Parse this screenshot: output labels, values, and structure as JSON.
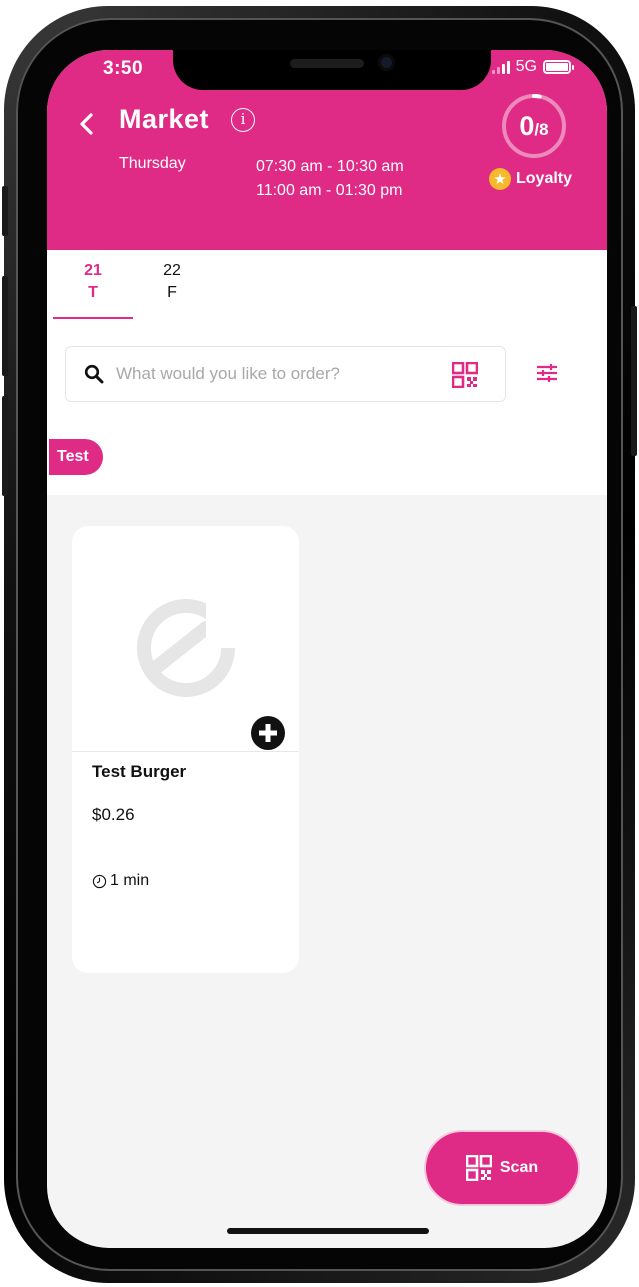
{
  "status": {
    "time": "3:50",
    "network": "5G"
  },
  "header": {
    "title": "Market",
    "info_icon_label": "i",
    "day": "Thursday",
    "hours": [
      "07:30 am - 10:30 am",
      "11:00 am - 01:30 pm"
    ]
  },
  "loyalty": {
    "count": "0",
    "total": "/8",
    "label": "Loyalty",
    "progress_fraction": 0.03
  },
  "date_tabs": [
    {
      "day_number": "21",
      "day_letter": "T",
      "active": true
    },
    {
      "day_number": "22",
      "day_letter": "F",
      "active": false
    }
  ],
  "search": {
    "placeholder": "What would you like to order?",
    "value": ""
  },
  "categories": [
    {
      "label": "Test",
      "active": true
    }
  ],
  "products": [
    {
      "name": "Test Burger",
      "price": "$0.26",
      "prep_time": "1 min"
    }
  ],
  "scan_button": {
    "label": "Scan"
  },
  "colors": {
    "brand": "#df2a86",
    "star": "#f6b92b",
    "background": "#f4f4f4"
  },
  "icons": [
    "back-icon",
    "info-icon",
    "star-icon",
    "search-icon",
    "qr-code-icon",
    "filter-icon",
    "plus-circle-icon",
    "clock-icon"
  ]
}
